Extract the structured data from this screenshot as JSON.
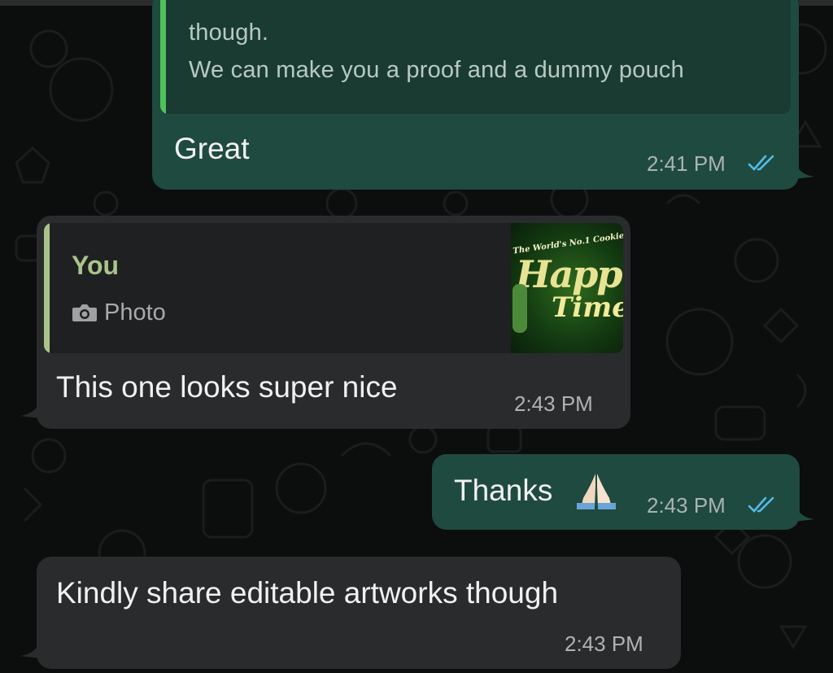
{
  "messages": [
    {
      "id": "m1",
      "direction": "outgoing",
      "quoted_lines": [
        "though.",
        "We can make  you a proof and a dummy pouch"
      ],
      "text": "Great",
      "time": "2:41 PM",
      "read_icon": "double-check-icon"
    },
    {
      "id": "m2",
      "direction": "incoming",
      "reply": {
        "author": "You",
        "type_label": "Photo",
        "type_icon": "camera-icon"
      },
      "thumbnail": {
        "caption": "The World's No.1 Cookie",
        "word1": "Happ",
        "word2": "Time"
      },
      "text": "This one looks super nice",
      "time": "2:43 PM"
    },
    {
      "id": "m3",
      "direction": "outgoing",
      "text": "Thanks",
      "emoji": "🙏",
      "time": "2:43 PM",
      "read_icon": "double-check-icon"
    },
    {
      "id": "m4",
      "direction": "incoming",
      "text": "Kindly share editable artworks though",
      "time": "2:43 PM"
    }
  ],
  "colors": {
    "outgoing_bubble": "#1f4a3f",
    "incoming_bubble": "#2a2b2d",
    "read_ticks": "#53bdeb",
    "quote_bar_outgoing": "#4fc35a",
    "quote_bar_incoming": "#a9c48a"
  }
}
